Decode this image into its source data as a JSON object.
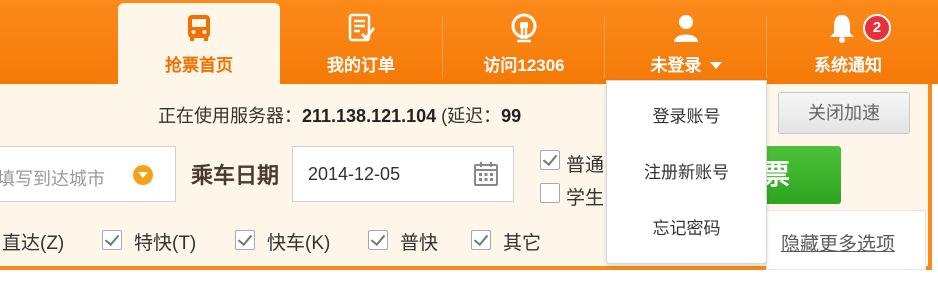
{
  "nav": {
    "tabs": [
      {
        "label": "抢票首页",
        "icon": "bus-icon",
        "active": true
      },
      {
        "label": "我的订单",
        "icon": "order-list-icon"
      },
      {
        "label": "访问12306",
        "icon": "train-head-icon"
      },
      {
        "label": "未登录",
        "icon": "user-icon"
      },
      {
        "label": "系统通知",
        "icon": "bell-icon",
        "badge": "2"
      }
    ]
  },
  "user_menu": {
    "items": [
      "登录账号",
      "注册新账号",
      "忘记密码"
    ]
  },
  "server": {
    "prefix": "正在使用服务器：",
    "ip": "211.138.121.104",
    "latency_prefix": "(延迟：",
    "latency_value": "99"
  },
  "accelerate": {
    "close_label": "关闭加速"
  },
  "search": {
    "to_city_placeholder": "填写到达城市",
    "date_label": "乘车日期",
    "date_value": "2014-12-05",
    "ticket_types": [
      {
        "label": "普通",
        "checked": true
      },
      {
        "label": "学生",
        "checked": false
      }
    ],
    "query_label": "票"
  },
  "filters": {
    "items": [
      {
        "label": "直达(Z)",
        "checked": true
      },
      {
        "label": "特快(T)",
        "checked": true
      },
      {
        "label": "快车(K)",
        "checked": true
      },
      {
        "label": "普快",
        "checked": true
      },
      {
        "label": "其它",
        "checked": true
      }
    ],
    "more_label": "隐藏更多选项"
  },
  "colors": {
    "nav_orange": "#f98a18",
    "active_text": "#f26f00",
    "panel_bg": "#fdf6e9",
    "query_green": "#3db12c",
    "badge_red": "#e8303a"
  }
}
